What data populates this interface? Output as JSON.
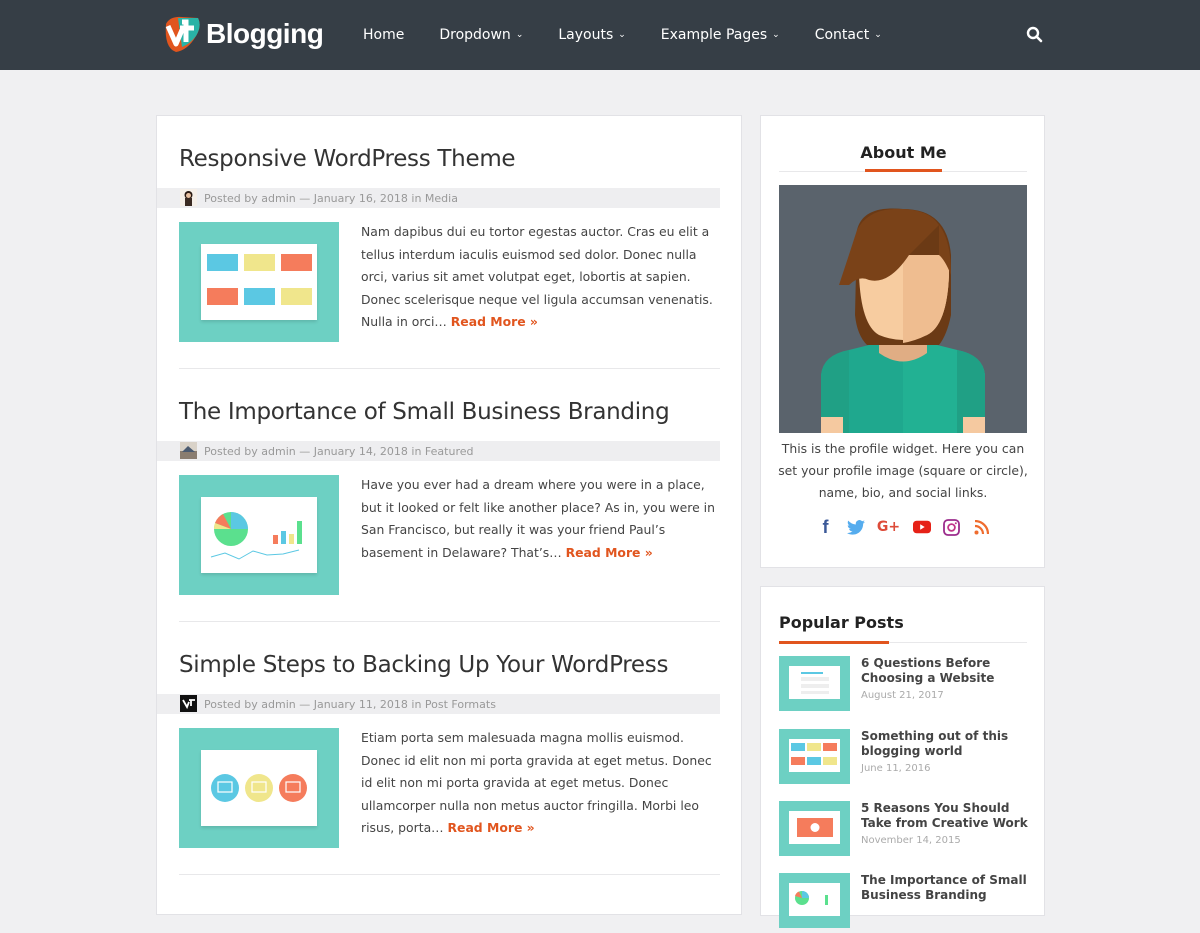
{
  "brand": {
    "name": "Blogging",
    "accent": "#e1551e",
    "header_bg": "#363e46",
    "thumb_bg": "#6dd0c3"
  },
  "nav": {
    "items": [
      {
        "label": "Home",
        "dropdown": false
      },
      {
        "label": "Dropdown",
        "dropdown": true
      },
      {
        "label": "Layouts",
        "dropdown": true
      },
      {
        "label": "Example Pages",
        "dropdown": true
      },
      {
        "label": "Contact",
        "dropdown": true
      }
    ],
    "search_icon": "search-icon"
  },
  "posts": [
    {
      "title": "Responsive WordPress Theme",
      "meta_prefix": "Posted by admin — January 16, 2018 in ",
      "category": "Media",
      "excerpt": "Nam dapibus dui eu tortor egestas auctor. Cras eu elit a tellus interdum iaculis euismod sed dolor. Donec nulla orci, varius sit amet volutpat eget, lobortis at sapien. Donec scelerisque neque vel ligula accumsan venenatis. Nulla in orci… ",
      "read_more": "Read More »"
    },
    {
      "title": "The Importance of Small Business Branding",
      "meta_prefix": "Posted by admin — January 14, 2018 in ",
      "category": "Featured",
      "excerpt": "Have you ever had a dream where you were in a place, but it looked or felt like another place? As in, you were in San Francisco, but really it was your friend Paul’s basement in Delaware? That’s… ",
      "read_more": "Read More »"
    },
    {
      "title": "Simple Steps to Backing Up Your WordPress",
      "meta_prefix": "Posted by admin — January 11, 2018 in ",
      "category": "Post Formats",
      "excerpt": "Etiam porta sem malesuada magna mollis euismod. Donec id elit non mi porta gravida at eget metus. Donec id elit non mi porta gravida at eget metus. Donec ullamcorper nulla non metus auctor fringilla. Morbi leo risus, porta… ",
      "read_more": "Read More »"
    }
  ],
  "about": {
    "title": "About Me",
    "text": "This is the profile widget. Here you can set your profile image (square or circle), name, bio, and social links.",
    "social": [
      "facebook",
      "twitter",
      "google-plus",
      "youtube",
      "instagram",
      "rss"
    ]
  },
  "popular": {
    "title": "Popular Posts",
    "items": [
      {
        "title": "6 Questions Before Choosing a Website",
        "date": "August 21, 2017"
      },
      {
        "title": "Something out of this blogging world",
        "date": "June 11, 2016"
      },
      {
        "title": "5 Reasons You Should Take from Creative Work",
        "date": "November 14, 2015"
      },
      {
        "title": "The Importance of Small Business Branding",
        "date": ""
      }
    ]
  }
}
